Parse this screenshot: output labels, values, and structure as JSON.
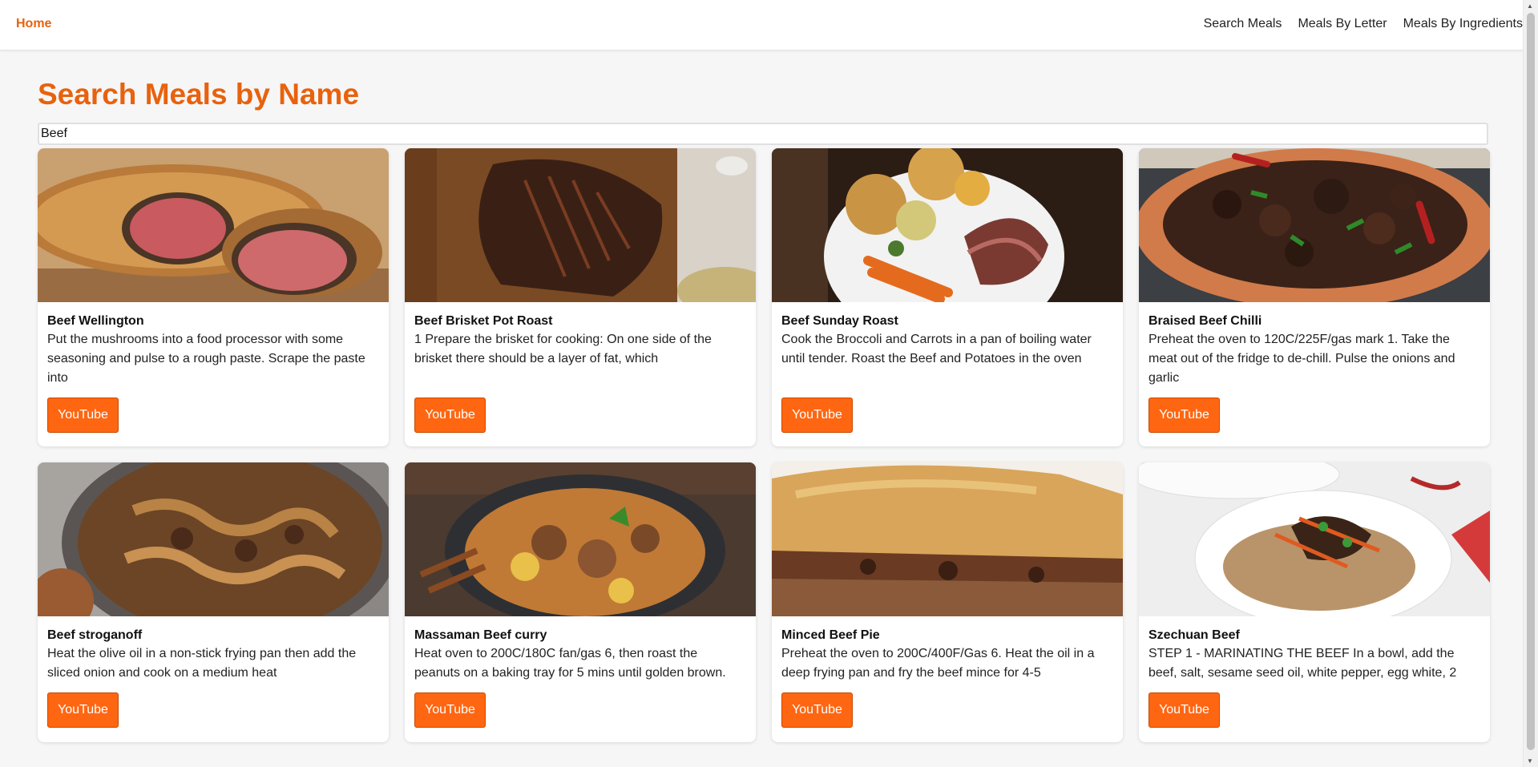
{
  "nav": {
    "home": "Home",
    "links": [
      "Search Meals",
      "Meals By Letter",
      "Meals By Ingredients"
    ]
  },
  "page": {
    "title": "Search Meals by Name",
    "search_value": "Beef"
  },
  "meals": [
    {
      "name": "Beef Wellington",
      "description": "Put the mushrooms into a food processor with some seasoning and pulse to a rough paste. Scrape the paste into",
      "button": "YouTube"
    },
    {
      "name": "Beef Brisket Pot Roast",
      "description": "1 Prepare the brisket for cooking: On one side of the brisket there should be a layer of fat, which",
      "button": "YouTube"
    },
    {
      "name": "Beef Sunday Roast",
      "description": "Cook the Broccoli and Carrots in a pan of boiling water until tender. Roast the Beef and Potatoes in the oven",
      "button": "YouTube"
    },
    {
      "name": "Braised Beef Chilli",
      "description": "Preheat the oven to 120C/225F/gas mark 1. Take the meat out of the fridge to de-chill. Pulse the onions and garlic",
      "button": "YouTube"
    },
    {
      "name": "Beef stroganoff",
      "description": "Heat the olive oil in a non-stick frying pan then add the sliced onion and cook on a medium heat",
      "button": "YouTube"
    },
    {
      "name": "Massaman Beef curry",
      "description": "Heat oven to 200C/180C fan/gas 6, then roast the peanuts on a baking tray for 5 mins until golden brown.",
      "button": "YouTube"
    },
    {
      "name": "Minced Beef Pie",
      "description": "Preheat the oven to 200C/400F/Gas 6. Heat the oil in a deep frying pan and fry the beef mince for 4-5",
      "button": "YouTube"
    },
    {
      "name": "Szechuan Beef",
      "description": "STEP 1 - MARINATING THE BEEF In a bowl, add the beef, salt, sesame seed oil, white pepper, egg white, 2",
      "button": "YouTube"
    }
  ],
  "colors": {
    "accent": "#e8620d",
    "button": "#ff6611"
  }
}
